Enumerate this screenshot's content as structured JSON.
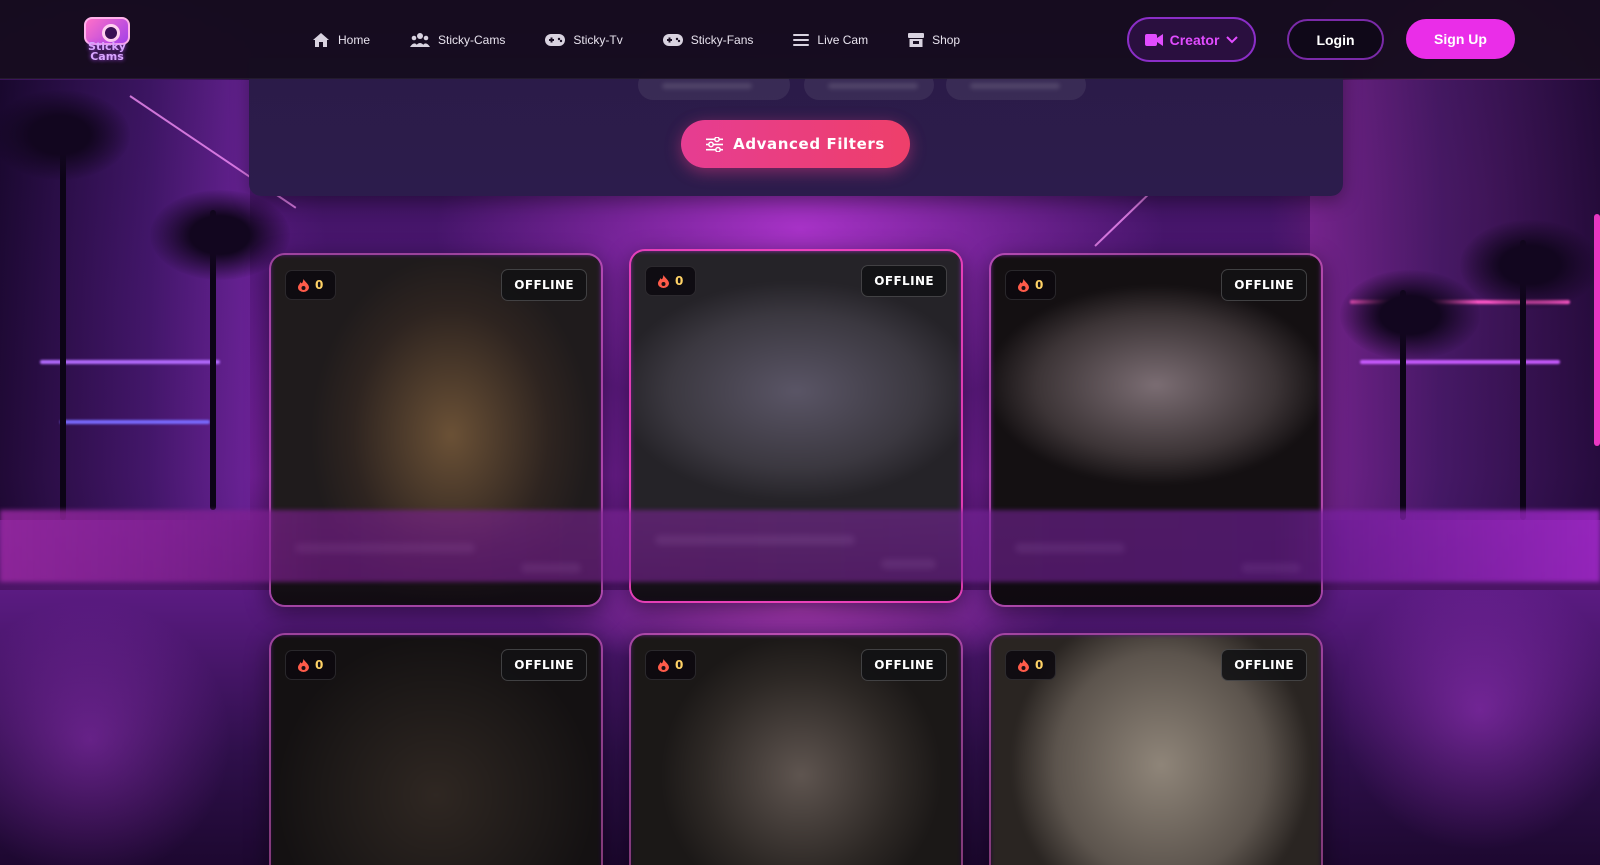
{
  "brand": {
    "logo_line1": "Sticky",
    "logo_line2": "Cams"
  },
  "nav": [
    {
      "label": "Home",
      "icon": "home-icon"
    },
    {
      "label": "Sticky-Cams",
      "icon": "users-icon"
    },
    {
      "label": "Sticky-Tv",
      "icon": "gamepad-icon"
    },
    {
      "label": "Sticky-Fans",
      "icon": "gamepad-icon"
    },
    {
      "label": "Live Cam",
      "icon": "menu-icon"
    },
    {
      "label": "Shop",
      "icon": "store-icon"
    }
  ],
  "header_actions": {
    "creator": "Creator",
    "login": "Login",
    "signup": "Sign Up"
  },
  "filters": {
    "advanced_label": "Advanced Filters"
  },
  "cards": [
    {
      "viewers": "0",
      "status": "OFFLINE"
    },
    {
      "viewers": "0",
      "status": "OFFLINE"
    },
    {
      "viewers": "0",
      "status": "OFFLINE"
    },
    {
      "viewers": "0",
      "status": "OFFLINE"
    },
    {
      "viewers": "0",
      "status": "OFFLINE"
    },
    {
      "viewers": "0",
      "status": "OFFLINE"
    }
  ],
  "colors": {
    "accent_pink": "#ea2de8",
    "creator_text": "#e14cff",
    "filter_button": "#e63d92",
    "viewer_count": "#ffd266",
    "header_bg": "#160c1e"
  }
}
